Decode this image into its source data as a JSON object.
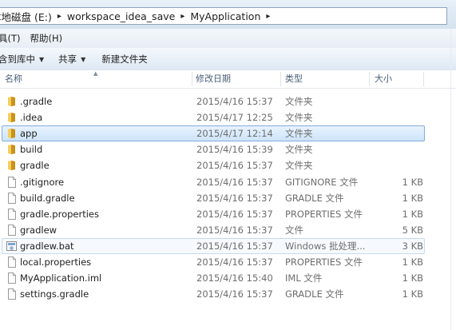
{
  "address": {
    "crumbs": [
      "本地磁盘 (E:)",
      "workspace_idea_save",
      "MyApplication"
    ],
    "separator": "▸"
  },
  "menu": {
    "items": [
      "具(T)",
      "帮助(H)"
    ]
  },
  "toolbar": {
    "buttons": [
      {
        "label": "含到库中",
        "has_dropdown": true
      },
      {
        "label": "共享",
        "has_dropdown": true
      },
      {
        "label": "新建文件夹",
        "has_dropdown": false
      }
    ]
  },
  "columns": {
    "name": "名称",
    "date": "修改日期",
    "type": "类型",
    "size": "大小"
  },
  "files": [
    {
      "name": ".gradle",
      "date": "2015/4/16 15:37",
      "type": "文件夹",
      "size": "",
      "icon": "folder-icon",
      "state": ""
    },
    {
      "name": ".idea",
      "date": "2015/4/17 12:25",
      "type": "文件夹",
      "size": "",
      "icon": "folder-icon",
      "state": ""
    },
    {
      "name": "app",
      "date": "2015/4/17 12:14",
      "type": "文件夹",
      "size": "",
      "icon": "folder-icon",
      "state": "selected"
    },
    {
      "name": "build",
      "date": "2015/4/16 15:39",
      "type": "文件夹",
      "size": "",
      "icon": "folder-icon",
      "state": ""
    },
    {
      "name": "gradle",
      "date": "2015/4/16 15:37",
      "type": "文件夹",
      "size": "",
      "icon": "folder-icon",
      "state": ""
    },
    {
      "name": ".gitignore",
      "date": "2015/4/16 15:37",
      "type": "GITIGNORE 文件",
      "size": "1 KB",
      "icon": "file-icon",
      "state": ""
    },
    {
      "name": "build.gradle",
      "date": "2015/4/16 15:37",
      "type": "GRADLE 文件",
      "size": "1 KB",
      "icon": "file-icon",
      "state": ""
    },
    {
      "name": "gradle.properties",
      "date": "2015/4/16 15:37",
      "type": "PROPERTIES 文件",
      "size": "1 KB",
      "icon": "file-icon",
      "state": ""
    },
    {
      "name": "gradlew",
      "date": "2015/4/16 15:37",
      "type": "文件",
      "size": "5 KB",
      "icon": "file-icon",
      "state": ""
    },
    {
      "name": "gradlew.bat",
      "date": "2015/4/16 15:37",
      "type": "Windows 批处理...",
      "size": "3 KB",
      "icon": "batch-file-icon",
      "state": "hover"
    },
    {
      "name": "local.properties",
      "date": "2015/4/16 15:37",
      "type": "PROPERTIES 文件",
      "size": "1 KB",
      "icon": "file-icon",
      "state": ""
    },
    {
      "name": "MyApplication.iml",
      "date": "2015/4/16 15:40",
      "type": "IML 文件",
      "size": "1 KB",
      "icon": "file-icon",
      "state": ""
    },
    {
      "name": "settings.gradle",
      "date": "2015/4/16 15:37",
      "type": "GRADLE 文件",
      "size": "1 KB",
      "icon": "file-icon",
      "state": ""
    }
  ],
  "colors": {
    "selection_border": "#84acdd",
    "selection_fill": "#cde4fa",
    "folder_yellow": "#e8b830"
  }
}
